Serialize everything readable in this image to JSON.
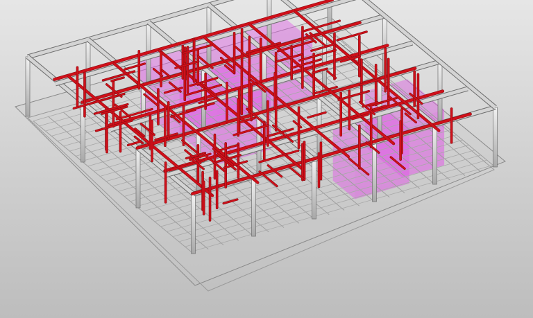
{
  "viewport": {
    "view_name": "",
    "background_top": "#e6e6e6",
    "background_bottom": "#bdbdbd"
  },
  "model": {
    "structure_color": "#d4d4d4",
    "structure_edge": "#6e6e6e",
    "pipe_color": "#d0101a",
    "pipe_dark": "#8c0b10",
    "zone_color": "#e05ce6",
    "zone_opacity": 0.55
  }
}
